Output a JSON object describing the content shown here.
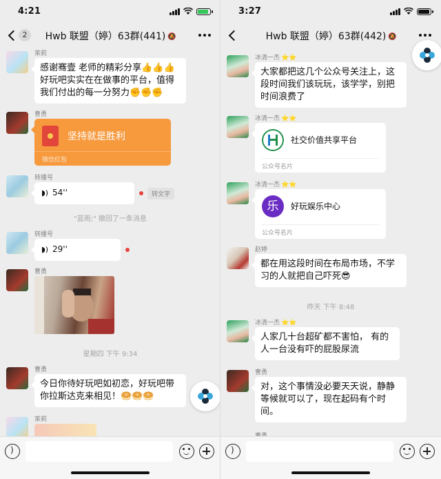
{
  "left": {
    "status": {
      "time": "4:21",
      "battery_color": "#34c759"
    },
    "nav": {
      "back_badge": "2",
      "title": "Hwb 联盟（婷）63群(441)"
    },
    "messages": {
      "m1": {
        "sender": "茉莉",
        "text_line1": "感谢骞壹 老师的精彩分享👍👍👍",
        "text_line2": "好玩吧实实在在做事的平台，值得",
        "text_line3": "我们付出的每一分努力✊✊✊"
      },
      "m2": {
        "sender": "曹勇",
        "packet_text": "坚持就是胜利",
        "packet_footer": "微信红包"
      },
      "m3": {
        "sender": "转播号",
        "duration": "54''",
        "convert_label": "转文字"
      },
      "recall": "\"蓝雨;\" 撤回了一条消息",
      "m4": {
        "sender": "转播号",
        "duration": "29''"
      },
      "m5": {
        "sender": "曹勇"
      },
      "time_divider": "星期四 下午 9:34",
      "m6": {
        "sender": "曹勇",
        "text_line1": "今日你待好玩吧如初恋，好玩吧带",
        "text_line2": "你拉斯达克来相见！🥯🥯🥯"
      },
      "m7": {
        "sender": "茉莉"
      }
    }
  },
  "right": {
    "status": {
      "time": "3:27",
      "battery_color": "#111111"
    },
    "nav": {
      "title": "Hwb 联盟（婷）63群(442)"
    },
    "messages": {
      "r1": {
        "sender": "冰清一杰",
        "text_line1": "大家都把这几个公众号关注上，这",
        "text_line2": "段时间我们该玩玩，该学学，别把",
        "text_line3": "时间浪费了"
      },
      "r2": {
        "sender": "冰清一杰",
        "card_name": "社交价值共享平台",
        "card_kind": "公众号名片"
      },
      "r3": {
        "sender": "冰清一杰",
        "card_name": "好玩娱乐中心",
        "card_kind": "公众号名片",
        "logo_char": "乐"
      },
      "r4": {
        "sender": "赵婷",
        "text_line1": "都在用这段时间在布局市场，不学",
        "text_line2": "习的人就把自己吓死😎"
      },
      "time_divider": "昨天 下午 8:48",
      "r5": {
        "sender": "冰清一杰",
        "text_line1": "人家几十台超矿都不害怕， 有的",
        "text_line2": "人一台没有吓的屁股尿流"
      },
      "r6": {
        "sender": "曹勇",
        "text_line1": "对，这个事情没必要天天说，静静",
        "text_line2": "等候就可以了，现在起码有个时",
        "text_line3": "间。"
      },
      "r7": {
        "sender": "曹勇"
      }
    }
  },
  "stars": "⭐⭐",
  "icons": {
    "voice": "voice-input-icon",
    "emoji": "emoji-icon",
    "plus": "plus-icon",
    "more": "more-icon",
    "mute": "mute-icon"
  },
  "colors": {
    "red_packet": "#f79a3e",
    "bubble": "#ffffff",
    "background": "#ededed",
    "recall_red": "#e64340"
  }
}
